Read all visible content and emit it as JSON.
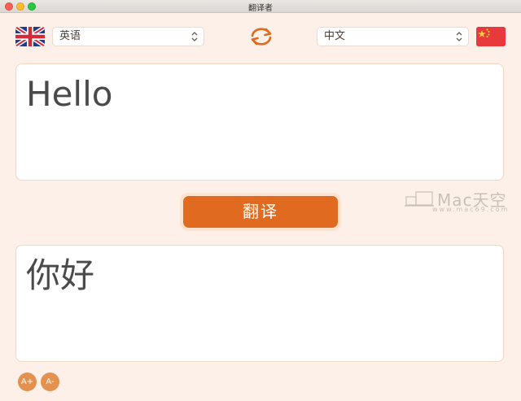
{
  "window": {
    "title": "翻译者"
  },
  "languages": {
    "source": {
      "label": "英语",
      "flag_icon": "uk-flag-icon"
    },
    "target": {
      "label": "中文",
      "flag_icon": "china-flag-icon"
    },
    "swap_icon": "swap-arrows-icon"
  },
  "input": {
    "text": "Hello"
  },
  "actions": {
    "translate_label": "翻译"
  },
  "output": {
    "text": "你好"
  },
  "font_controls": {
    "increase_label": "A+",
    "decrease_label": "A-"
  },
  "watermark": {
    "brand": "Mac天空",
    "url": "www.mac69.com"
  },
  "colors": {
    "accent": "#e06a1f",
    "background": "#fcf0e9",
    "font_button": "#e4904f"
  }
}
